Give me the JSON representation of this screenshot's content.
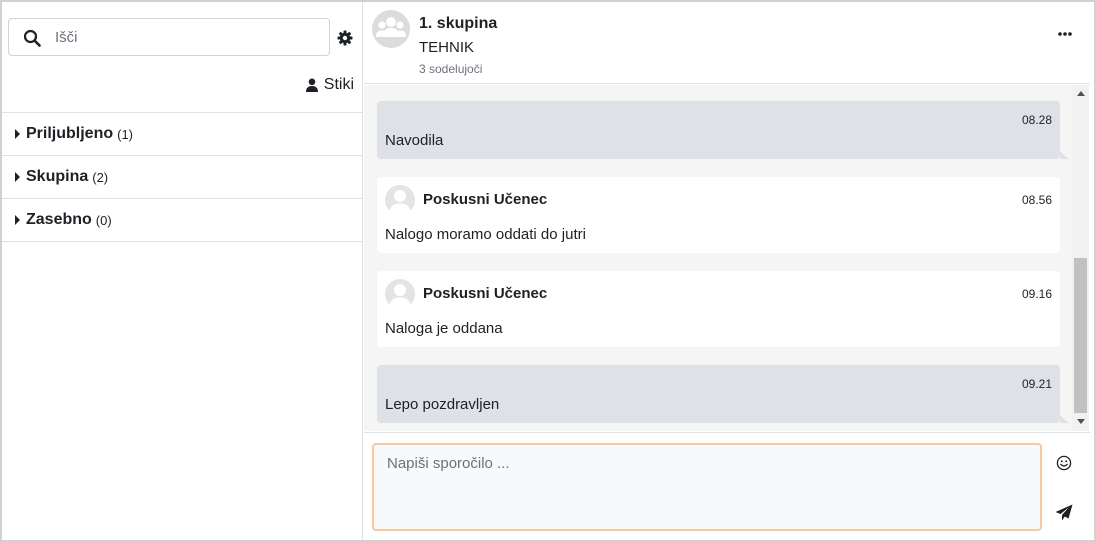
{
  "sidebar": {
    "search_placeholder": "Išči",
    "contacts_label": "Stiki",
    "sections": [
      {
        "name": "Priljubljeno",
        "count": "(1)"
      },
      {
        "name": "Skupina",
        "count": "(2)"
      },
      {
        "name": "Zasebno",
        "count": "(0)"
      }
    ]
  },
  "conversation": {
    "title": "1. skupina",
    "subtitle": "TEHNIK",
    "participants": "3 sodelujoči",
    "messages": [
      {
        "own": true,
        "time": "08.28",
        "text": "Navodila"
      },
      {
        "own": false,
        "sender": "Poskusni Učenec",
        "time": "08.56",
        "text": "Nalogo moramo oddati do jutri"
      },
      {
        "own": false,
        "sender": "Poskusni Učenec",
        "time": "09.16",
        "text": "Naloga je oddana"
      },
      {
        "own": true,
        "time": "09.21",
        "text": "Lepo pozdravljen"
      }
    ],
    "composer_placeholder": "Napiši sporočilo ..."
  },
  "icons": {
    "search": "search-icon",
    "settings": "gear-icon",
    "contacts": "user-icon",
    "more": "ellipsis-icon",
    "emoji": "smile-icon",
    "send": "paper-plane-icon"
  },
  "colors": {
    "own_bubble": "#dee2e6",
    "other_bubble": "#ffffff",
    "message_area": "#f5f5f5",
    "composer_border": "#f6c9a3"
  }
}
